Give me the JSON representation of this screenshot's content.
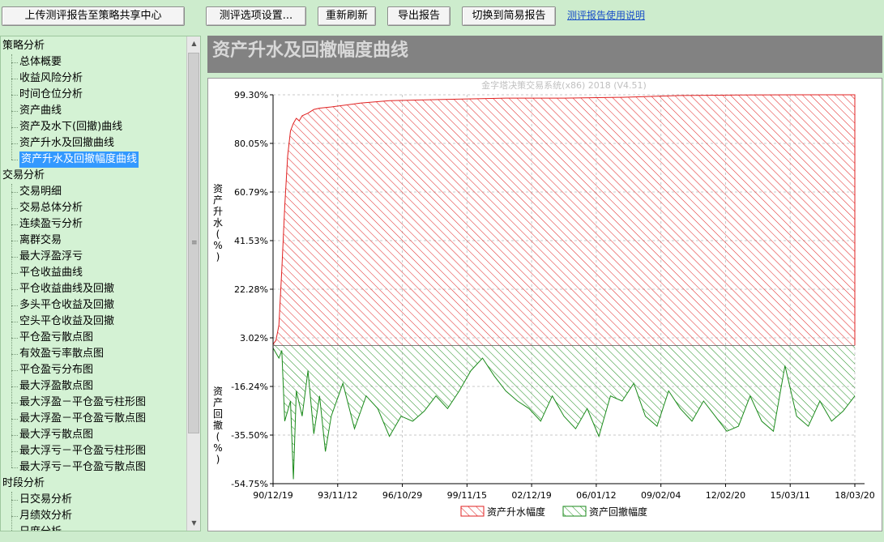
{
  "toolbar": {
    "upload": "上传测评报告至策略共享中心",
    "options": "测评选项设置...",
    "refresh": "重新刷新",
    "export": "导出报告",
    "simple": "切换到简易报告",
    "help": "测评报告使用说明"
  },
  "sidebar": {
    "groups": [
      {
        "label": "策略分析",
        "items": [
          "总体概要",
          "收益风险分析",
          "时间仓位分析",
          "资产曲线",
          "资产及水下(回撤)曲线",
          "资产升水及回撤曲线",
          "资产升水及回撤幅度曲线"
        ]
      },
      {
        "label": "交易分析",
        "items": [
          "交易明细",
          "交易总体分析",
          "连续盈亏分析",
          "离群交易",
          "最大浮盈浮亏",
          "平仓收益曲线",
          "平仓收益曲线及回撤",
          "多头平仓收益及回撤",
          "空头平仓收益及回撤",
          "平仓盈亏散点图",
          "有效盈亏率散点图",
          "平仓盈亏分布图",
          "最大浮盈散点图",
          "最大浮盈－平仓盈亏柱形图",
          "最大浮盈－平仓盈亏散点图",
          "最大浮亏散点图",
          "最大浮亏－平仓盈亏柱形图",
          "最大浮亏－平仓盈亏散点图"
        ]
      },
      {
        "label": "时段分析",
        "items": [
          "日交易分析",
          "月绩效分析",
          "日度分析"
        ]
      }
    ],
    "selected": "资产升水及回撤幅度曲线"
  },
  "page_title": "资产升水及回撤幅度曲线",
  "chart_data": {
    "type": "area",
    "watermark": "金字塔决策交易系统(x86) 2018 (V4.51)",
    "ylabel_top": "资产升水(%)",
    "ylabel_bottom": "资产回撤(%)",
    "yticks": [
      "99.30%",
      "80.05%",
      "60.79%",
      "41.53%",
      "22.28%",
      "3.02%",
      "-16.24%",
      "-35.50%",
      "-54.75%"
    ],
    "ytick_values": [
      99.3,
      80.05,
      60.79,
      41.53,
      22.28,
      3.02,
      -16.24,
      -35.5,
      -54.75
    ],
    "ylim": [
      -54.75,
      99.3
    ],
    "zero_line": 0,
    "xticks": [
      "90/12/19",
      "93/11/12",
      "96/10/29",
      "99/11/15",
      "02/12/19",
      "06/01/12",
      "09/02/04",
      "12/02/20",
      "15/03/11",
      "18/03/20"
    ],
    "legend": [
      "资产升水幅度",
      "资产回撤幅度"
    ],
    "colors": {
      "premium": "#e02020",
      "drawdown": "#1a8a1a"
    },
    "premium_series": {
      "t": [
        0.0,
        0.005,
        0.01,
        0.015,
        0.02,
        0.025,
        0.03,
        0.035,
        0.04,
        0.045,
        0.05,
        0.06,
        0.07,
        0.08,
        0.1,
        0.15,
        0.2,
        0.3,
        0.4,
        0.5,
        0.6,
        0.7,
        0.8,
        0.9,
        1.0
      ],
      "v": [
        0.5,
        2.0,
        8.0,
        30.0,
        55.0,
        75.0,
        85.0,
        88.0,
        90.0,
        89.0,
        91.0,
        92.0,
        93.5,
        94.0,
        94.5,
        96.0,
        97.0,
        97.5,
        98.0,
        98.0,
        98.3,
        99.0,
        99.2,
        99.3,
        99.3
      ]
    },
    "drawdown_series": {
      "t": [
        0.0,
        0.01,
        0.015,
        0.02,
        0.03,
        0.035,
        0.04,
        0.05,
        0.06,
        0.07,
        0.08,
        0.09,
        0.1,
        0.12,
        0.14,
        0.16,
        0.18,
        0.2,
        0.22,
        0.24,
        0.26,
        0.28,
        0.3,
        0.32,
        0.34,
        0.36,
        0.38,
        0.4,
        0.42,
        0.44,
        0.46,
        0.48,
        0.5,
        0.52,
        0.54,
        0.56,
        0.58,
        0.6,
        0.62,
        0.64,
        0.66,
        0.68,
        0.7,
        0.72,
        0.74,
        0.76,
        0.78,
        0.8,
        0.82,
        0.84,
        0.86,
        0.88,
        0.9,
        0.92,
        0.94,
        0.96,
        0.98,
        1.0
      ],
      "v": [
        -1,
        -5,
        -2,
        -30,
        -22,
        -53,
        -18,
        -28,
        -10,
        -35,
        -20,
        -42,
        -28,
        -15,
        -33,
        -20,
        -25,
        -36,
        -28,
        -30,
        -26,
        -20,
        -25,
        -18,
        -10,
        -5,
        -12,
        -18,
        -22,
        -25,
        -30,
        -20,
        -28,
        -33,
        -25,
        -36,
        -20,
        -22,
        -15,
        -28,
        -32,
        -18,
        -25,
        -30,
        -22,
        -28,
        -34,
        -32,
        -20,
        -30,
        -34,
        -8,
        -28,
        -32,
        -22,
        -30,
        -26,
        -20
      ]
    }
  }
}
